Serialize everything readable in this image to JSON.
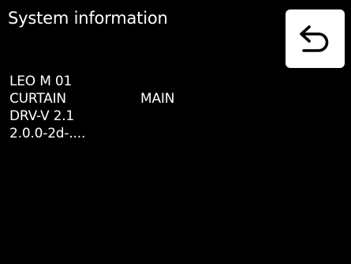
{
  "header": {
    "title": "System information",
    "back_icon": "back-arrow-icon"
  },
  "info": {
    "line1": "LEO M 01",
    "line2_left": "CURTAIN",
    "line2_right": "MAIN",
    "line3": "DRV-V 2.1",
    "line4": "2.0.0-2d-...."
  },
  "colors": {
    "background": "#000000",
    "text": "#ffffff",
    "button_bg": "#ffffff",
    "icon": "#000000"
  }
}
